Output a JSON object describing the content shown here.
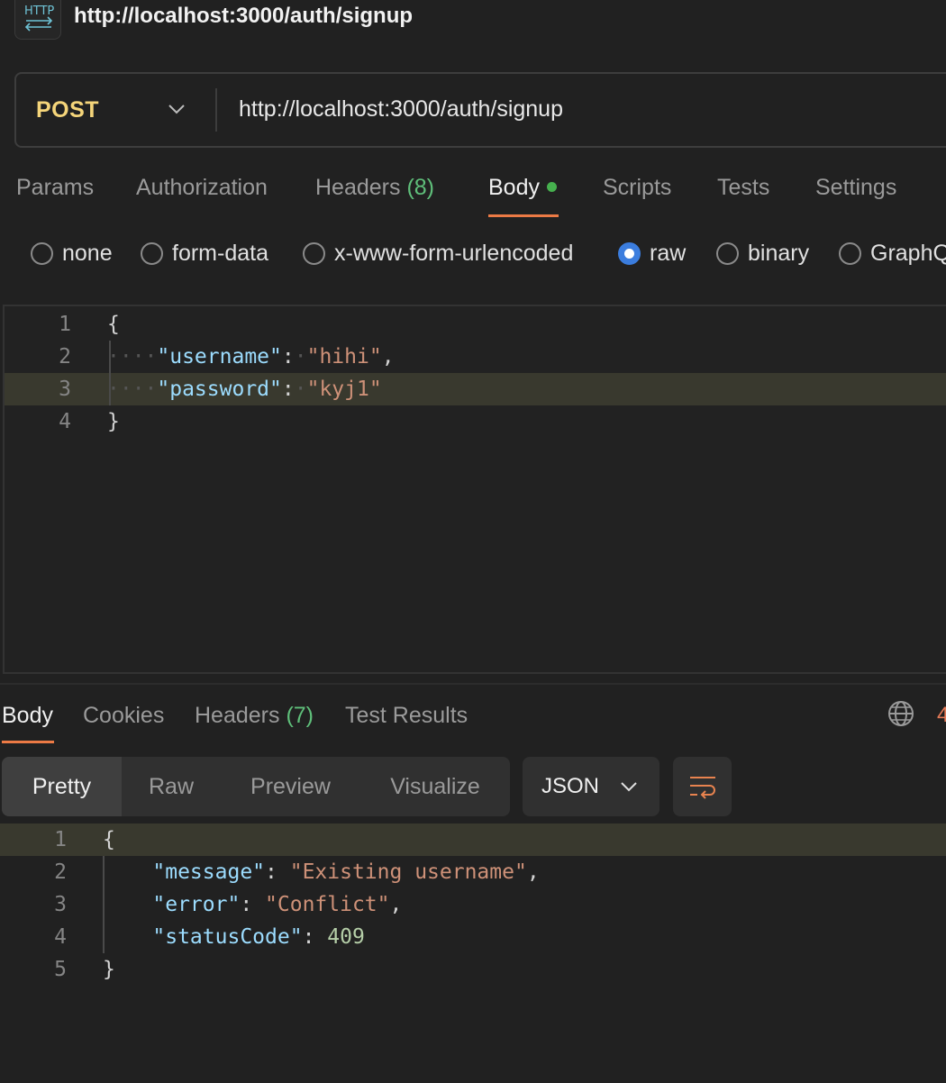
{
  "header": {
    "icon": "http-icon",
    "title": "http://localhost:3000/auth/signup"
  },
  "request": {
    "method": "POST",
    "url": "http://localhost:3000/auth/signup",
    "tabs": [
      {
        "label": "Params"
      },
      {
        "label": "Authorization"
      },
      {
        "label": "Headers",
        "count": "(8)"
      },
      {
        "label": "Body",
        "active": true
      },
      {
        "label": "Scripts"
      },
      {
        "label": "Tests"
      },
      {
        "label": "Settings"
      }
    ],
    "body_modes": [
      "none",
      "form-data",
      "x-www-form-urlencoded",
      "raw",
      "binary",
      "GraphQ"
    ],
    "selected_mode": "raw",
    "body_lines": {
      "l1": {
        "num": "1",
        "open": "{"
      },
      "l2": {
        "num": "2",
        "key": "\"username\"",
        "val": "\"hihi\""
      },
      "l3": {
        "num": "3",
        "key": "\"password\"",
        "val": "\"kyj1\""
      },
      "l4": {
        "num": "4",
        "close": "}"
      }
    }
  },
  "response": {
    "tabs": [
      {
        "label": "Body",
        "active": true
      },
      {
        "label": "Cookies"
      },
      {
        "label": "Headers",
        "count": "(7)"
      },
      {
        "label": "Test Results"
      }
    ],
    "status_peek": "4",
    "view_modes": [
      "Pretty",
      "Raw",
      "Preview",
      "Visualize"
    ],
    "selected_view": "Pretty",
    "format": "JSON",
    "lines": {
      "l1": {
        "num": "1",
        "open": "{"
      },
      "l2": {
        "num": "2",
        "key": "\"message\"",
        "val": "\"Existing username\""
      },
      "l3": {
        "num": "3",
        "key": "\"error\"",
        "val": "\"Conflict\""
      },
      "l4": {
        "num": "4",
        "key": "\"statusCode\"",
        "val": "409"
      },
      "l5": {
        "num": "5",
        "close": "}"
      }
    }
  },
  "colors": {
    "accent_underline": "#ec7a45",
    "method": "#f5d57a",
    "count_green": "#5fbf7a",
    "radio_selected": "#3b7dde"
  }
}
